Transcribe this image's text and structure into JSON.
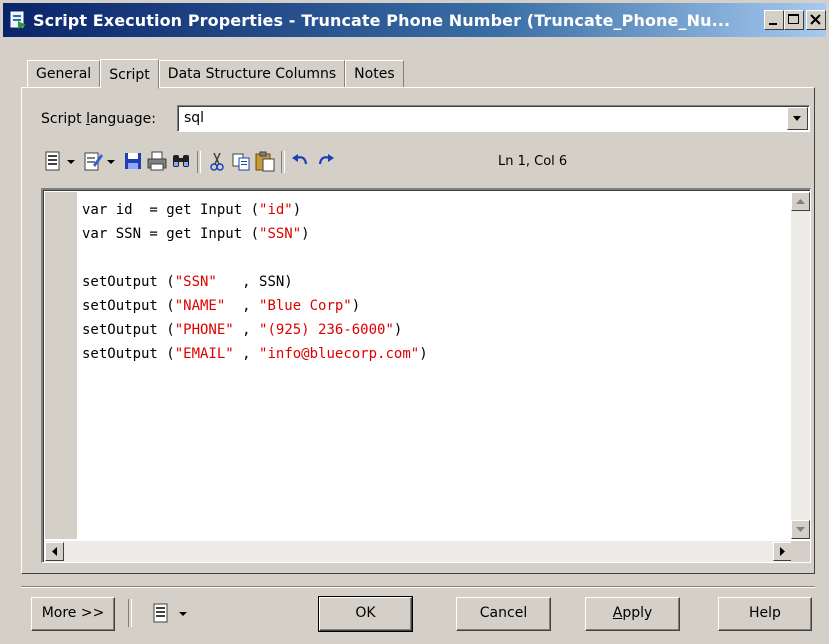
{
  "window": {
    "title": "Script Execution Properties - Truncate Phone Number (Truncate_Phone_Nu...",
    "controls": [
      "minimize-icon",
      "maximize-icon",
      "close-icon"
    ]
  },
  "tabs": [
    {
      "label": "General",
      "active": false
    },
    {
      "label": "Script",
      "active": true
    },
    {
      "label": "Data Structure Columns",
      "active": false
    },
    {
      "label": "Notes",
      "active": false
    }
  ],
  "script_language": {
    "label_pre": "Script ",
    "label_underlined": "l",
    "label_post": "anguage:",
    "value": "sql"
  },
  "toolbar": {
    "icons": [
      "properties-icon",
      "edit-icon",
      "save-icon",
      "print-icon",
      "find-icon",
      "cut-icon",
      "copy-icon",
      "paste-icon",
      "undo-icon",
      "redo-icon"
    ],
    "position": "Ln 1, Col 6"
  },
  "code": {
    "lines": [
      [
        {
          "t": "var id  = get Input ("
        },
        {
          "t": "\"id\"",
          "s": 1
        },
        {
          "t": ")"
        }
      ],
      [
        {
          "t": "var SSN = get Input ("
        },
        {
          "t": "\"SSN\"",
          "s": 1
        },
        {
          "t": ")"
        }
      ],
      [
        {
          "t": ""
        }
      ],
      [
        {
          "t": "setOutput ("
        },
        {
          "t": "\"SSN\"",
          "s": 1
        },
        {
          "t": "   , SSN)"
        }
      ],
      [
        {
          "t": "setOutput ("
        },
        {
          "t": "\"NAME\"",
          "s": 1
        },
        {
          "t": "  , "
        },
        {
          "t": "\"Blue Corp\"",
          "s": 1
        },
        {
          "t": ")"
        }
      ],
      [
        {
          "t": "setOutput ("
        },
        {
          "t": "\"PHONE\"",
          "s": 1
        },
        {
          "t": " , "
        },
        {
          "t": "\"(925) 236-6000\"",
          "s": 1
        },
        {
          "t": ")"
        }
      ],
      [
        {
          "t": "setOutput ("
        },
        {
          "t": "\"EMAIL\"",
          "s": 1
        },
        {
          "t": " , "
        },
        {
          "t": "\"info@bluecorp.com\"",
          "s": 1
        },
        {
          "t": ")"
        }
      ]
    ]
  },
  "buttons": {
    "more": "More >>",
    "ok": "OK",
    "cancel": "Cancel",
    "apply_underlined": "A",
    "apply_rest": "pply",
    "help": "Help"
  },
  "colors": {
    "face": "#d4d0c8",
    "title_start": "#0a246a",
    "title_end": "#a6caf0",
    "string": "#e00000"
  }
}
